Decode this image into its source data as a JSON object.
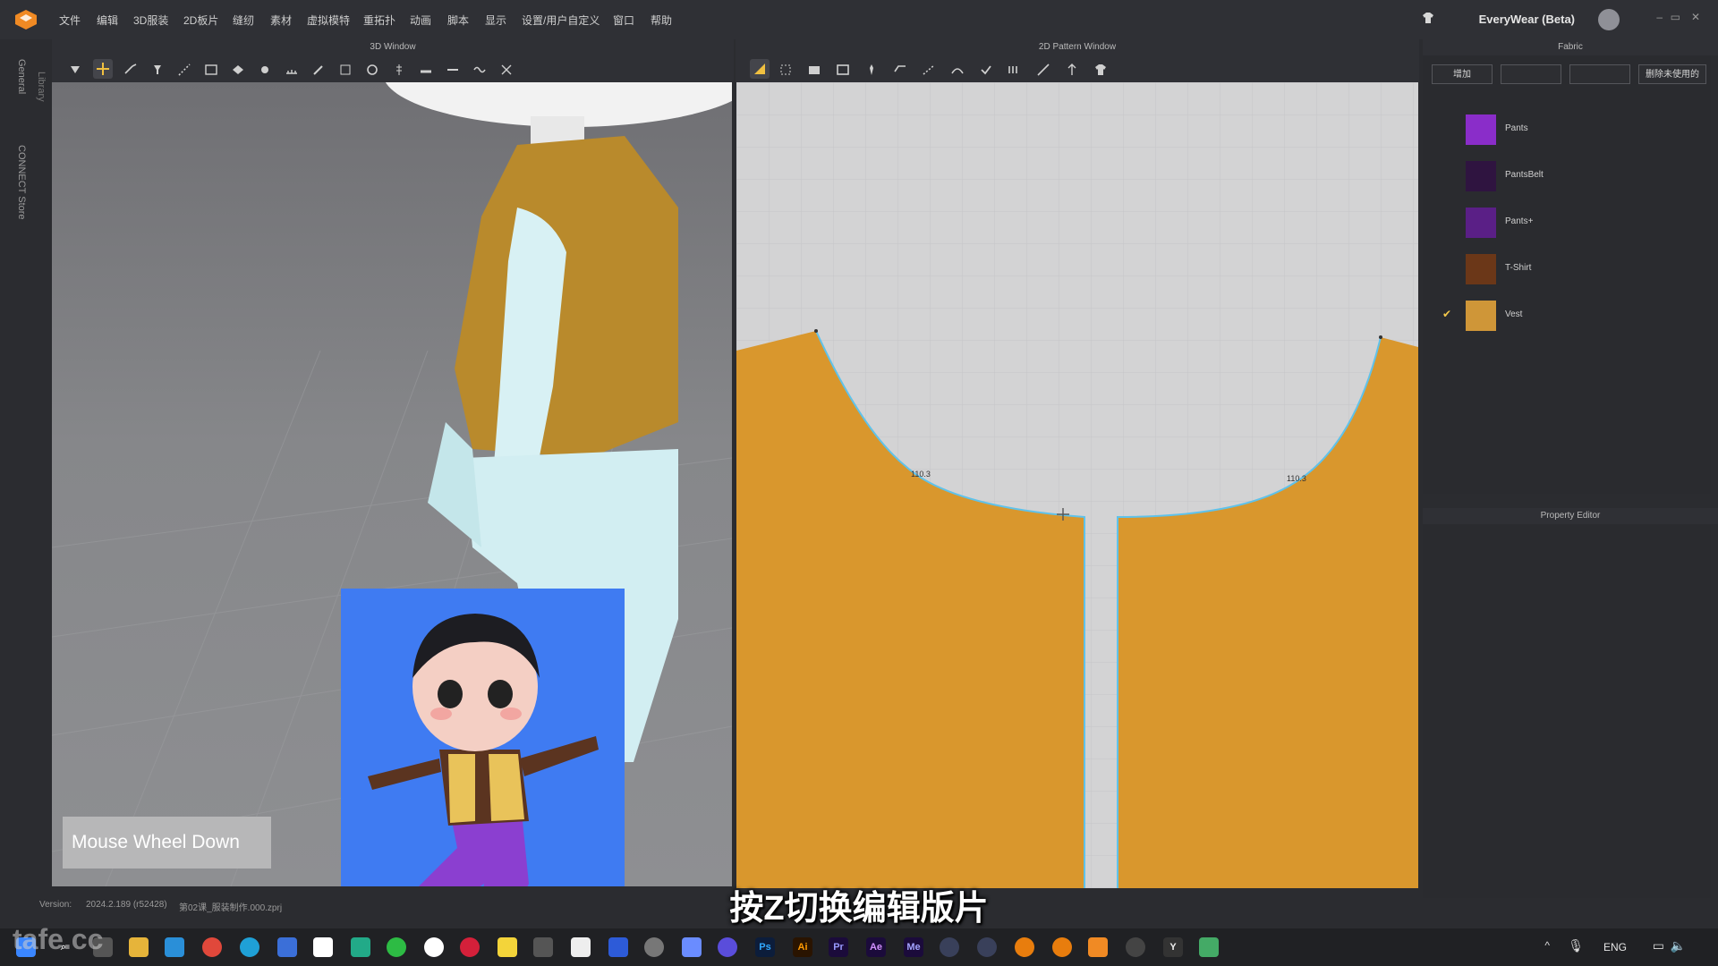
{
  "app": {
    "menu": [
      "文件",
      "编辑",
      "3D服装",
      "2D板片",
      "缝纫",
      "素材",
      "虚拟模特",
      "重拓扑",
      "动画",
      "脚本",
      "显示",
      "设置/用户自定义",
      "窗口",
      "帮助"
    ],
    "product_name": "EveryWear (Beta)"
  },
  "left_rail": [
    "General",
    "Library",
    "CONNECT Store"
  ],
  "window3d": {
    "title": "3D Window",
    "hint": "Mouse Wheel Down"
  },
  "window2d": {
    "title": "2D Pattern Window",
    "measure_left": "110.3",
    "measure_right": "110.3"
  },
  "fabric": {
    "title": "Fabric",
    "buttons": [
      "增加",
      "",
      "",
      "删除未使用的"
    ],
    "items": [
      {
        "name": "Pants",
        "color": "#8a2dc9",
        "checked": false
      },
      {
        "name": "PantsBelt",
        "color": "#2f1440",
        "checked": false
      },
      {
        "name": "Pants+",
        "color": "#5a1f86",
        "checked": false
      },
      {
        "name": "T-Shirt",
        "color": "#6b3718",
        "checked": false
      },
      {
        "name": "Vest",
        "color": "#cf9638",
        "checked": true
      }
    ]
  },
  "property_editor": {
    "title": "Property Editor"
  },
  "status": {
    "version_label": "Version:",
    "version": "2024.2.189 (r52428)",
    "file": "第02课_服装制作.000.zprj"
  },
  "subtitle": "按Z切换编辑版片",
  "taskbar": {
    "lang": "ENG"
  },
  "watermark": "tafe.cc",
  "colors": {
    "pattern_fill": "#d9972d",
    "seam_outline": "#5fc2ea",
    "grid_bg": "#d3d3d4",
    "photo_bg": "#3f7bf2"
  }
}
